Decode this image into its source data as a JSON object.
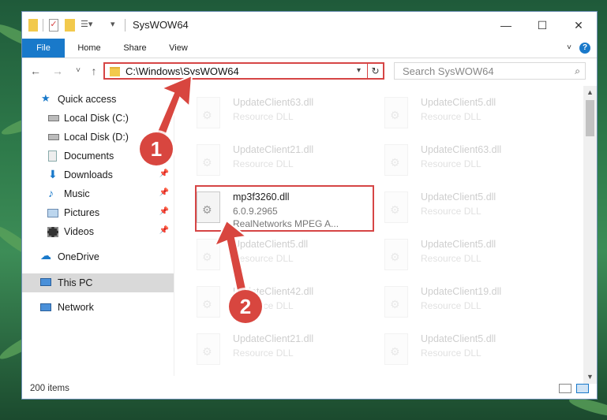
{
  "window": {
    "title": "SysWOW64",
    "controls": {
      "minimize": "—",
      "maximize": "☐",
      "close": "✕"
    }
  },
  "ribbon": {
    "tabs": [
      {
        "label": "File"
      },
      {
        "label": "Home"
      },
      {
        "label": "Share"
      },
      {
        "label": "View"
      }
    ],
    "help": "?"
  },
  "nav": {
    "back": "←",
    "forward": "→",
    "recent": "˅",
    "up": "↑",
    "address": "C:\\Windows\\SysWOW64",
    "refresh": "↻",
    "search_placeholder": "Search SysWOW64"
  },
  "sidebar": {
    "items": [
      {
        "label": "Quick access",
        "icon": "star-icon"
      },
      {
        "label": "Local Disk (C:)",
        "icon": "drive-icon"
      },
      {
        "label": "Local Disk (D:)",
        "icon": "drive-icon"
      },
      {
        "label": "Documents",
        "icon": "documents-icon"
      },
      {
        "label": "Downloads",
        "icon": "download-icon"
      },
      {
        "label": "Music",
        "icon": "music-icon"
      },
      {
        "label": "Pictures",
        "icon": "pictures-icon"
      },
      {
        "label": "Videos",
        "icon": "videos-icon"
      },
      {
        "label": "OneDrive",
        "icon": "cloud-icon"
      },
      {
        "label": "This PC",
        "icon": "computer-icon"
      },
      {
        "label": "Network",
        "icon": "network-icon"
      }
    ],
    "pin": "📌"
  },
  "files": {
    "left": [
      {
        "name": "UpdateClient63.dll",
        "type": "Resource DLL"
      },
      {
        "name": "UpdateClient21.dll",
        "type": "Resource DLL"
      },
      {
        "name": "mp3f3260.dll",
        "type": "6.0.9.2965",
        "desc": "RealNetworks MPEG A..."
      },
      {
        "name": "UpdateClient5.dll",
        "type": "Resource DLL"
      },
      {
        "name": "UpdateClient42.dll",
        "type": "Resource DLL"
      },
      {
        "name": "UpdateClient21.dll",
        "type": "Resource DLL"
      }
    ],
    "right": [
      {
        "name": "UpdateClient5.dll",
        "type": "Resource DLL"
      },
      {
        "name": "UpdateClient63.dll",
        "type": "Resource DLL"
      },
      {
        "name": "UpdateClient5.dll",
        "type": "Resource DLL"
      },
      {
        "name": "UpdateClient5.dll",
        "type": "Resource DLL"
      },
      {
        "name": "UpdateClient19.dll",
        "type": "Resource DLL"
      },
      {
        "name": "UpdateClient5.dll",
        "type": "Resource DLL"
      }
    ]
  },
  "status": {
    "item_count": "200 items"
  },
  "annotations": {
    "step1": "1",
    "step2": "2",
    "color": "#d8463f"
  }
}
